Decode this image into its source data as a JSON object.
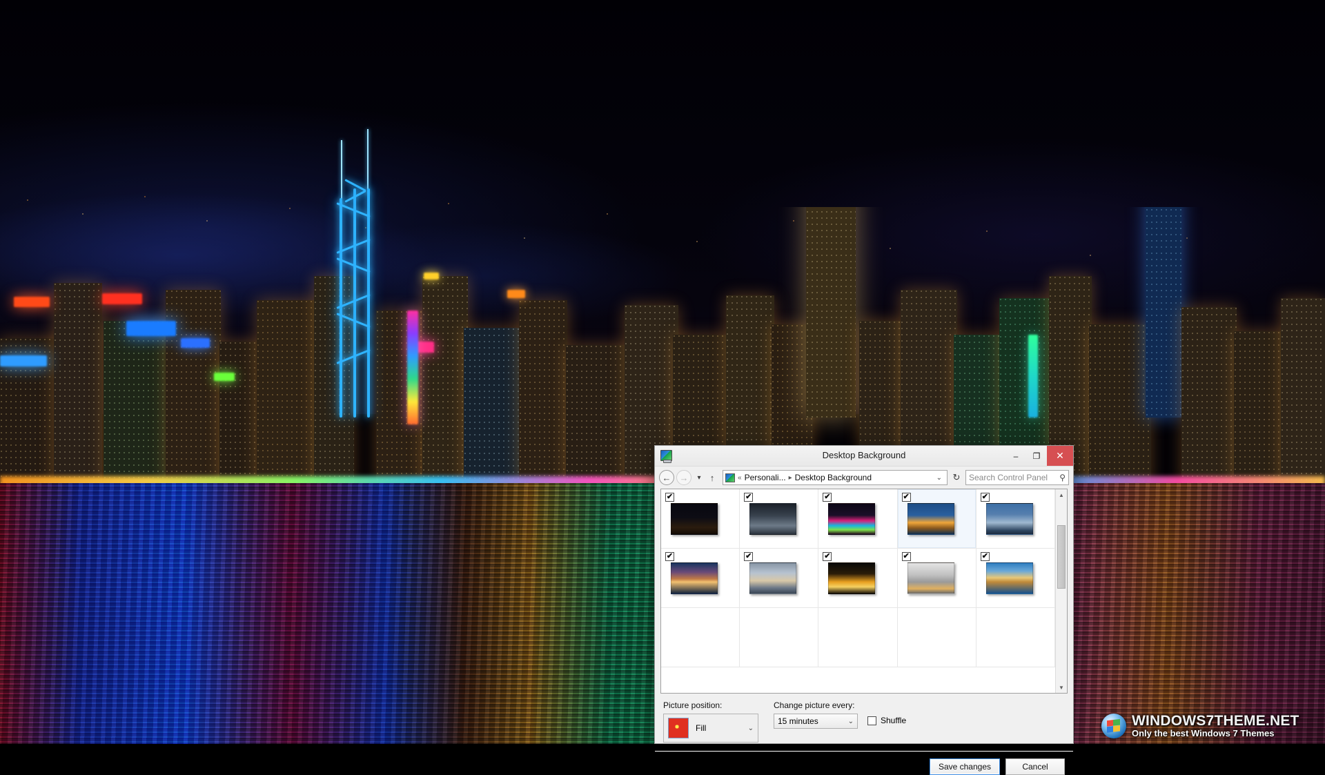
{
  "desktop": {
    "wallpaper_description": "Hong Kong Victoria Harbour skyline at night with neon-lit skyscrapers and multicoloured water reflections",
    "accent_colors": [
      "#1f8fe0",
      "#ff57c8",
      "#60ff9a",
      "#ffc250",
      "#e03020"
    ]
  },
  "dialog": {
    "title": "Desktop Background",
    "icon": "personalization-monitor-icon",
    "window_buttons": {
      "minimize": "–",
      "maximize": "❐",
      "close": "✕",
      "close_color": "#d64f52"
    },
    "nav": {
      "back": "←",
      "forward": "→",
      "recent": "▾",
      "up": "↑",
      "refresh": "↻"
    },
    "address": {
      "icon": "control-panel-icon",
      "overflow": "«",
      "crumbs": [
        "Personali...",
        "Desktop Background"
      ],
      "separator": "▸",
      "dropdown_caret": "⌄"
    },
    "search": {
      "placeholder": "Search Control Panel",
      "icon": "search-magnifier-icon"
    },
    "thumbnails": {
      "checkbox_glyph": "✔",
      "selected_index": 3,
      "items": [
        {
          "name": "hk-harbour-fountain-night",
          "checked": true,
          "colors": [
            "#0a0a10",
            "#2a1a0c",
            "#f0b040",
            "#2b6fb8"
          ]
        },
        {
          "name": "hk-skyline-grey-dusk",
          "checked": true,
          "colors": [
            "#1a2028",
            "#39434f",
            "#8f9aa6",
            "#c8d2dc"
          ]
        },
        {
          "name": "hk-neon-reflections",
          "checked": true,
          "colors": [
            "#120a18",
            "#d8207a",
            "#17b7e0",
            "#7de04a"
          ]
        },
        {
          "name": "hk-blue-hour-waterfront",
          "checked": true,
          "colors": [
            "#0e2240",
            "#1d4d86",
            "#f0a63a",
            "#d9e6f5"
          ]
        },
        {
          "name": "hk-aerial-bay-daylight",
          "checked": true,
          "colors": [
            "#1c3050",
            "#3d6fa6",
            "#9fb8d0",
            "#e2ecf6"
          ]
        },
        {
          "name": "hk-sunset-harbour-panorama",
          "checked": true,
          "colors": [
            "#102038",
            "#b86a3a",
            "#f2c070",
            "#2a4a78"
          ]
        },
        {
          "name": "hk-mountain-view-city",
          "checked": true,
          "colors": [
            "#5a6878",
            "#9aa8b8",
            "#d8c8a8",
            "#3a4a5e"
          ]
        },
        {
          "name": "hk-street-traffic-trails",
          "checked": true,
          "colors": [
            "#0a0a08",
            "#e8a020",
            "#f5d060",
            "#2a60a0"
          ]
        },
        {
          "name": "hk-towers-fog-white",
          "checked": true,
          "colors": [
            "#d8d8d8",
            "#a8a8a8",
            "#e0b060",
            "#6a6a6a"
          ]
        },
        {
          "name": "hk-island-blue-clouds",
          "checked": true,
          "colors": [
            "#16508c",
            "#2f7ec0",
            "#e8c878",
            "#0d2a4a"
          ]
        }
      ]
    },
    "scrollbar": {
      "up_arrow": "▲",
      "down_arrow": "▼"
    },
    "picture_position": {
      "label": "Picture position:",
      "value": "Fill",
      "preview_icon": "flower-thumbnail",
      "caret": "⌄"
    },
    "change_picture": {
      "label": "Change picture every:",
      "value": "15 minutes",
      "caret": "⌄"
    },
    "shuffle": {
      "label": "Shuffle",
      "checked": false
    },
    "buttons": {
      "save": "Save changes",
      "cancel": "Cancel"
    }
  },
  "watermark": {
    "brand_prefix": "WINDOWS",
    "brand_seven": "7",
    "brand_suffix": "THEME.NET",
    "tagline": "Only the best Windows 7 Themes",
    "logo": "windows-flag-icon"
  }
}
